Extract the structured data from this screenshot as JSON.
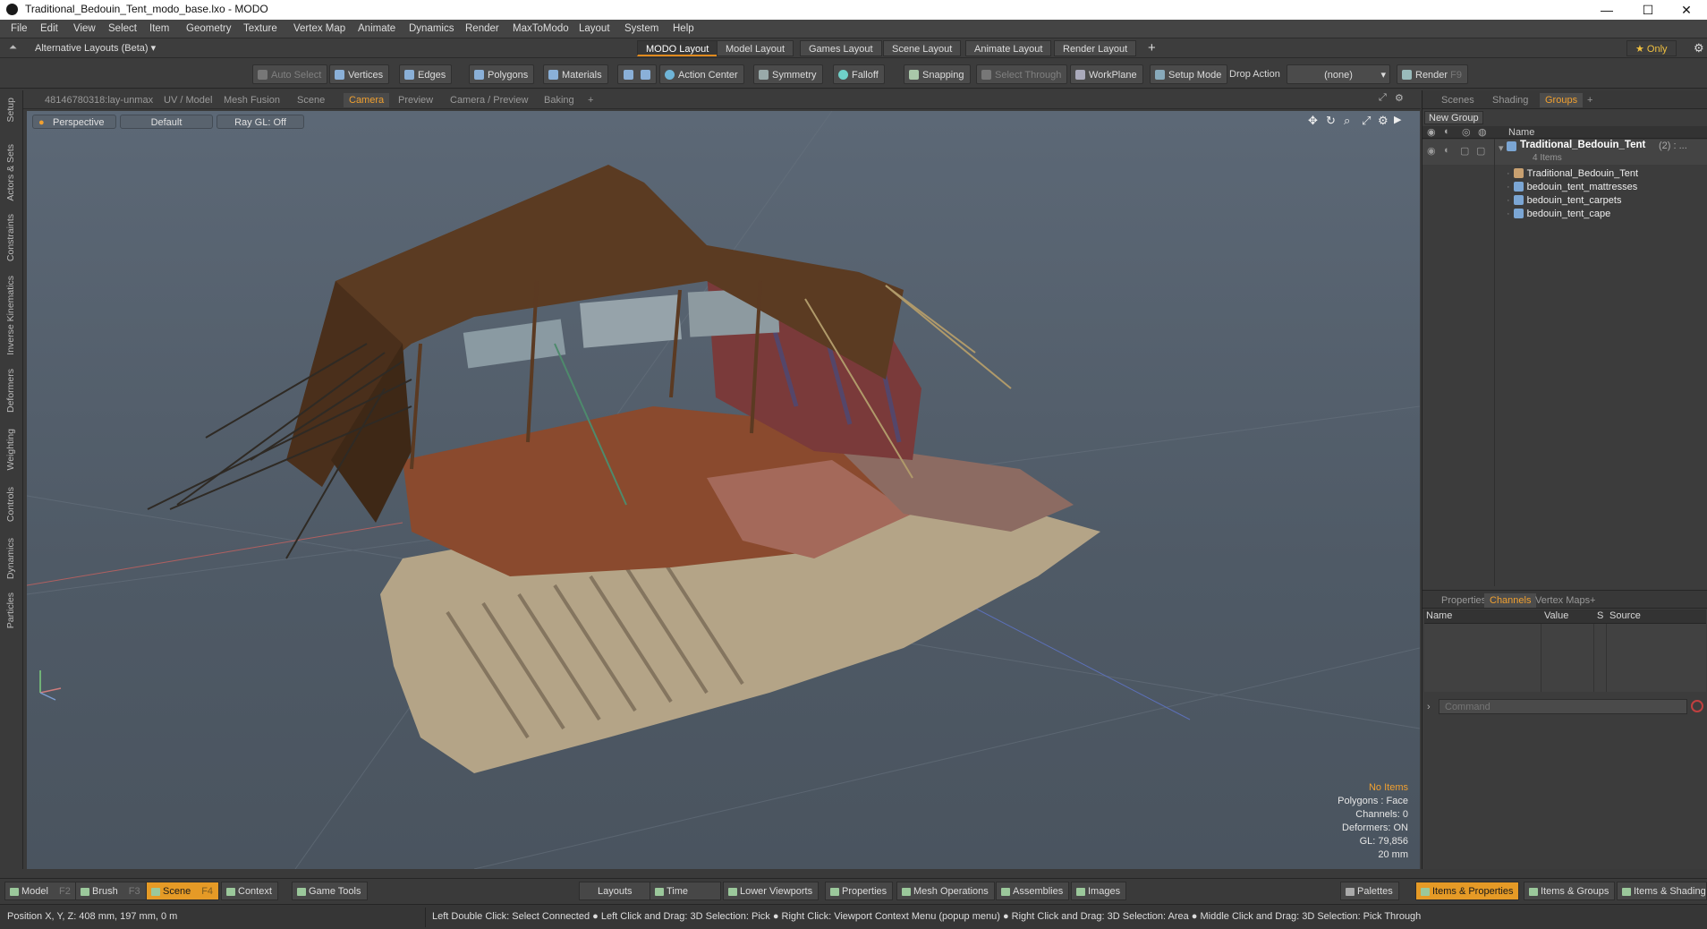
{
  "window": {
    "title": "Traditional_Bedouin_Tent_modo_base.lxo - MODO",
    "minimize": "—",
    "maximize": "☐",
    "close": "✕"
  },
  "menu": [
    "File",
    "Edit",
    "View",
    "Select",
    "Item",
    "Geometry",
    "Texture",
    "Vertex Map",
    "Animate",
    "Dynamics",
    "Render",
    "MaxToModo",
    "Layout",
    "System",
    "Help"
  ],
  "layoutbar": {
    "alt_layouts": "Alternative Layouts (Beta) ▾",
    "tabs": [
      "MODO Layout",
      "Model Layout",
      "Games Layout",
      "Scene Layout",
      "Animate Layout",
      "Render Layout"
    ],
    "active_tab": "MODO Layout",
    "add": "+",
    "only": "★  Only"
  },
  "toolbar": {
    "auto_select": "Auto Select",
    "vertices": "Vertices",
    "edges": "Edges",
    "polygons": "Polygons",
    "materials": "Materials",
    "action_center": "Action Center",
    "symmetry": "Symmetry",
    "falloff": "Falloff",
    "snapping": "Snapping",
    "select_through": "Select Through",
    "workplane": "WorkPlane",
    "setup_mode": "Setup Mode",
    "drop_action": "Drop Action",
    "drop_value": "(none)",
    "render": "Render",
    "render_key": "F9"
  },
  "viewport_tabs": [
    "48146780318:lay-unmax",
    "UV / Model",
    "Mesh Fusion",
    "Scene",
    "Camera",
    "Preview",
    "Camera / Preview",
    "Baking",
    "+"
  ],
  "viewport_active_tab": "Camera",
  "viewport": {
    "view": "Perspective",
    "style": "Default",
    "raygl": "Ray GL: Off"
  },
  "stats": {
    "selection": "No Items",
    "polygons": "Polygons : Face",
    "channels": "Channels: 0",
    "deformers": "Deformers: ON",
    "gl": "GL: 79,856",
    "scale": "20 mm"
  },
  "left_tabs": [
    "Setup",
    "Actors & Sets",
    "Constraints",
    "Inverse Kinematics",
    "Deformers",
    "Weighting",
    "Controls",
    "Dynamics",
    "Particles"
  ],
  "right_panel": {
    "tabs": [
      "Scenes",
      "Shading",
      "Groups",
      "+"
    ],
    "active_tab": "Groups",
    "new_group": "New Group",
    "name_col": "Name",
    "root": "Traditional_Bedouin_Tent",
    "root_count": "(2) : ...",
    "root_sub": "4 Items",
    "items": [
      "Traditional_Bedouin_Tent",
      "bedouin_tent_mattresses",
      "bedouin_tent_carpets",
      "bedouin_tent_cape"
    ]
  },
  "props_panel": {
    "tabs": [
      "Properties",
      "Channels",
      "Vertex Maps",
      "+"
    ],
    "active_tab": "Channels",
    "cols": [
      "Name",
      "Value",
      "S",
      "Source"
    ],
    "command_placeholder": "Command"
  },
  "bottombar": {
    "model": "Model",
    "model_key": "F2",
    "brush": "Brush",
    "brush_key": "F3",
    "scene": "Scene",
    "scene_key": "F4",
    "context": "Context",
    "game_tools": "Game Tools",
    "layouts": "Layouts",
    "time": "Time",
    "lower_viewports": "Lower Viewports",
    "properties": "Properties",
    "mesh_operations": "Mesh Operations",
    "assemblies": "Assemblies",
    "images": "Images",
    "palettes": "Palettes",
    "items_properties": "Items & Properties",
    "items_groups": "Items & Groups",
    "items_shading": "Items & Shading"
  },
  "statusbar": {
    "position": "Position X, Y, Z:   408 mm, 197 mm, 0 m",
    "hint": "Left Double Click: Select Connected ● Left Click and Drag: 3D Selection: Pick ● Right Click: Viewport Context Menu (popup menu) ● Right Click and Drag: 3D Selection: Area ● Middle Click and Drag: 3D Selection: Pick Through"
  },
  "colors": {
    "accent": "#e59a26",
    "viewport_bg": "#56616c"
  }
}
